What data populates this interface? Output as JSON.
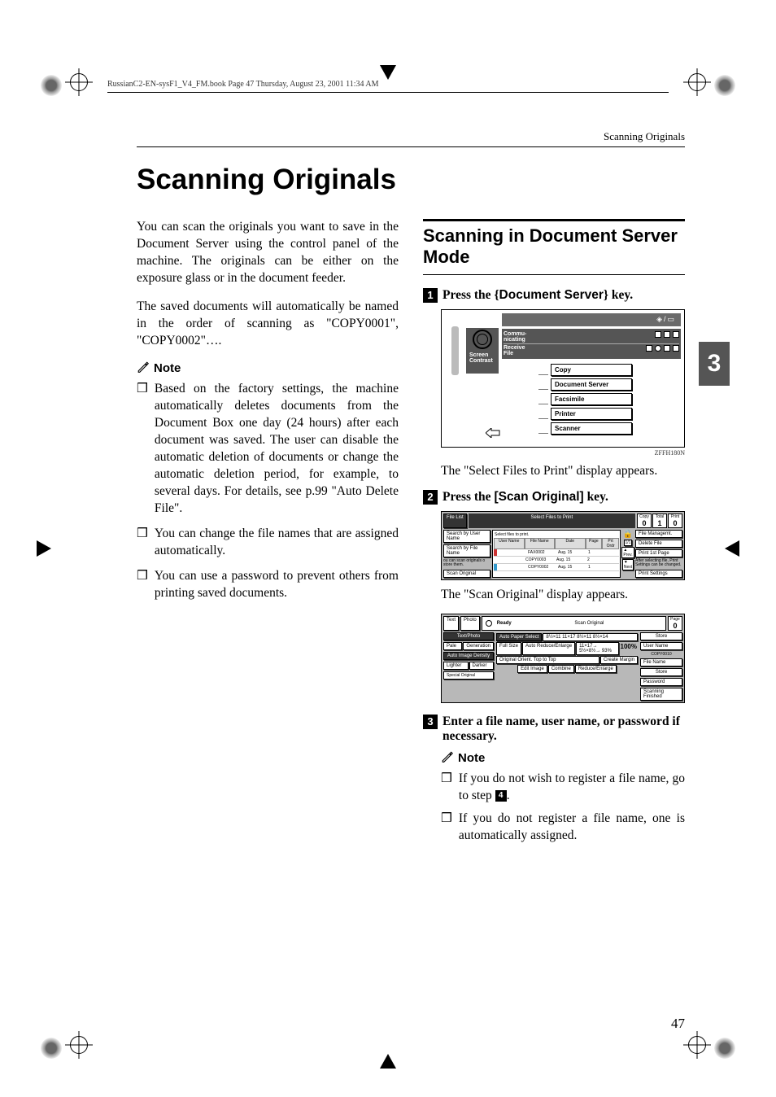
{
  "header": {
    "book_line": "RussianC2-EN-sysF1_V4_FM.book  Page 47  Thursday, August 23, 2001  11:34 AM"
  },
  "running_head": "Scanning Originals",
  "page_title": "Scanning Originals",
  "chapter_tab": "3",
  "page_number": "47",
  "left_column": {
    "para1": "You can scan the originals you want to save in the Document Server using the control panel of the machine. The originals can be either on the exposure glass or in the document feeder.",
    "para2": "The saved documents will automatically be named in the order of scanning as \"COPY0001\", \"COPY0002\"….",
    "note_label": "Note",
    "bullets": [
      "Based on the factory settings, the machine automatically deletes documents from the Document Box one day (24 hours) after each document was saved.  The user can disable the automatic deletion of documents or change the automatic deletion period, for example, to several days.  For details, see p.99 \"Auto Delete File\".",
      "You can change the file names that are assigned automatically.",
      "You can use a password to prevent others from printing saved documents."
    ]
  },
  "right_column": {
    "section_title": "Scanning in Document Server Mode",
    "steps": {
      "s1_pre": "Press the ",
      "s1_key": "Document Server",
      "s1_post": " key.",
      "s2_pre": "Press the ",
      "s2_key": "[Scan Original]",
      "s2_post": " key.",
      "s3_text": "Enter a file name, user name, or password if necessary."
    },
    "step_nums": {
      "n1": "1",
      "n2": "2",
      "n3": "3",
      "n4": "4"
    },
    "after1": "The \"Select Files to Print\" display appears.",
    "after2": "The \"Scan Original\" display appears.",
    "note_label": "Note",
    "sub_bullets_a": "If you do not wish to register a file name, go to step ",
    "sub_bullets_a_end": ".",
    "sub_bullets_b": "If you do not register a file name, one is automatically assigned."
  },
  "figure1": {
    "caption": "ZFFH180N",
    "toolbar": "◈/▭",
    "row1_l": "Commu-\nnicating",
    "row2_l": "Receive\nFile",
    "left_labels": "Screen\nContrast",
    "buttons": [
      "Copy",
      "Document Server",
      "Facsimile",
      "Printer",
      "Scanner"
    ]
  },
  "figure2": {
    "left_buttons": [
      "File List",
      "Search by User Name",
      "Search by File Name",
      "Scan Original"
    ],
    "left_note": "ou can scan originals\no store them.",
    "title": "Select Files to Print",
    "counters": [
      {
        "label": "Copy",
        "val": "0"
      },
      {
        "label": "Total",
        "val": "1"
      },
      {
        "label": "Print",
        "val": "0"
      }
    ],
    "hint": "Select files to print.",
    "headers": [
      "User Name",
      "File Name",
      "Date",
      "Page",
      "Prt Ordr"
    ],
    "rows": [
      [
        "",
        "FAX0002",
        "Aug.   15",
        "1",
        ""
      ],
      [
        "",
        "COPY0003",
        "Aug.   15",
        "2",
        ""
      ],
      [
        "",
        "COPY0002",
        "Aug.   15",
        "1",
        ""
      ]
    ],
    "right_buttons": [
      "File Managemt.",
      "Delete File",
      "Print 1st Page",
      "Print Settings"
    ],
    "right_note": "After selecting file, Print Settings can be changed.",
    "pager_top": "1/1",
    "pager": [
      "▲ Prev.",
      "▼ Next"
    ]
  },
  "figure3": {
    "left_tabs": [
      "Text",
      "Photo"
    ],
    "left_rows": [
      [
        "Pale",
        "Generation"
      ]
    ],
    "left_labels": [
      "Text/Photo",
      "Auto Image Density"
    ],
    "left_bottom": [
      "Lighter",
      "Darker"
    ],
    "memo": "Special Original",
    "ready": "Ready",
    "title": "Scan Original",
    "counter": {
      "label": "Page",
      "val": "0"
    },
    "mid_buttons": [
      "Auto Paper Select",
      "Full Size",
      "Auto Reduce/Enlarge"
    ],
    "paper_sizes": "8½×11  11×17  8½×11  8½×14",
    "ratio_buttons": "11×17→  5½×8½→  93%",
    "ratio": "100%",
    "orient": "Original Orient.  Top to Top",
    "margin": "Create Margin",
    "bottom_buttons": [
      "Edit Image",
      "Combine",
      "Reduce/Enlarge"
    ],
    "right_buttons": [
      "Store",
      "User Name",
      "COPY0010",
      "File Name",
      "Store",
      "Password",
      "Scanning Finished"
    ]
  }
}
